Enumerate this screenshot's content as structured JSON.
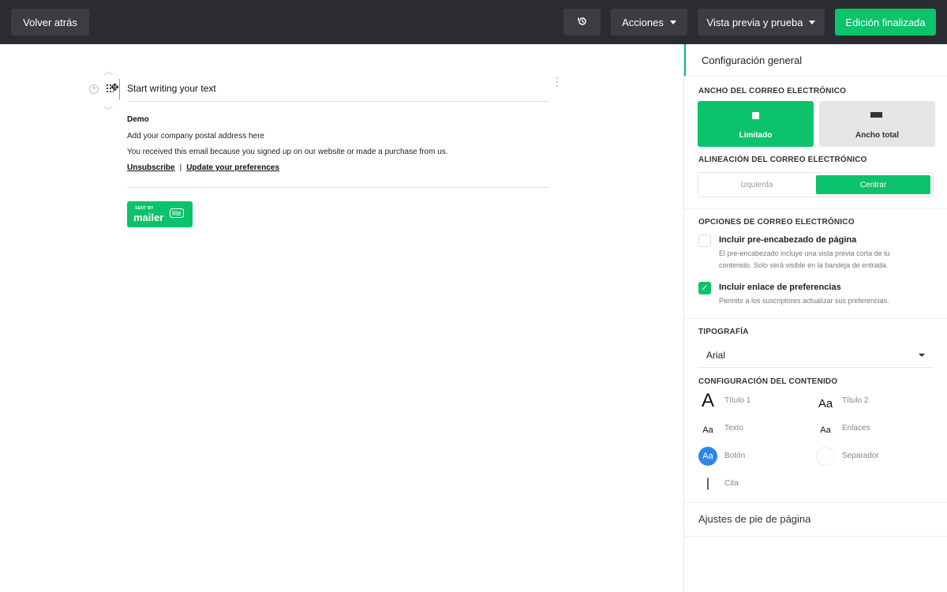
{
  "topbar": {
    "back_label": "Volver atrás",
    "history_icon": "history-icon",
    "actions_label": "Acciones",
    "preview_label": "Vista previa y prueba",
    "done_label": "Edición finalizada",
    "colors": {
      "bar": "#2b2c31",
      "button": "#3c3d42",
      "accent": "#0cc26b"
    }
  },
  "editor": {
    "text_block": "Start writing your text",
    "footer": {
      "company": "Demo",
      "address": "Add your company postal address here",
      "reason": "You received this email because you signed up on our website or made a purchase from us.",
      "unsubscribe": "Unsubscribe",
      "separator": "|",
      "preferences": "Update your preferences"
    },
    "badge": {
      "sent_by": "SENT BY",
      "brand": "mailer",
      "tag": "lite"
    }
  },
  "sidebar": {
    "header": "Configuración general",
    "width_section": "ANCHO DEL CORREO ELECTRÓNICO",
    "width_options": {
      "limited": "Limitado",
      "full": "Ancho total",
      "selected": "Limitado"
    },
    "align_section": "ALINEACIÓN DEL CORREO ELECTRÓNICO",
    "align_options": {
      "left": "Izquierda",
      "center": "Centrar",
      "selected": "Centrar"
    },
    "options_section": "OPCIONES DE CORREO ELECTRÓNICO",
    "preheader": {
      "title": "Incluir pre-encabezado de página",
      "desc": "El pre-encabezado incluye una vista previa corta de tu contenido. Solo será visible en la bandeja de entrada.",
      "checked": false
    },
    "preferences_link": {
      "title": "Incluir enlace de preferencias",
      "desc": "Permitir a los suscriptores actualizar sus preferencias.",
      "checked": true
    },
    "typography_section": "TIPOGRAFÍA",
    "font_value": "Arial",
    "content_section": "CONFIGURACIÓN DEL CONTENIDO",
    "content_items": {
      "title1": {
        "icon_text": "A",
        "label": "Título 1"
      },
      "title2": {
        "icon_text": "Aa",
        "label": "Título 2"
      },
      "text": {
        "icon_text": "Aa",
        "label": "Texto"
      },
      "links": {
        "icon_text": "Aa",
        "label": "Enlaces"
      },
      "button": {
        "icon_text": "Aa",
        "label": "Botón"
      },
      "separator": {
        "icon_text": "",
        "label": "Separador"
      },
      "quote": {
        "icon_text": "|",
        "label": "Cita"
      }
    },
    "footer_settings": "Ajustes de pie de página"
  }
}
